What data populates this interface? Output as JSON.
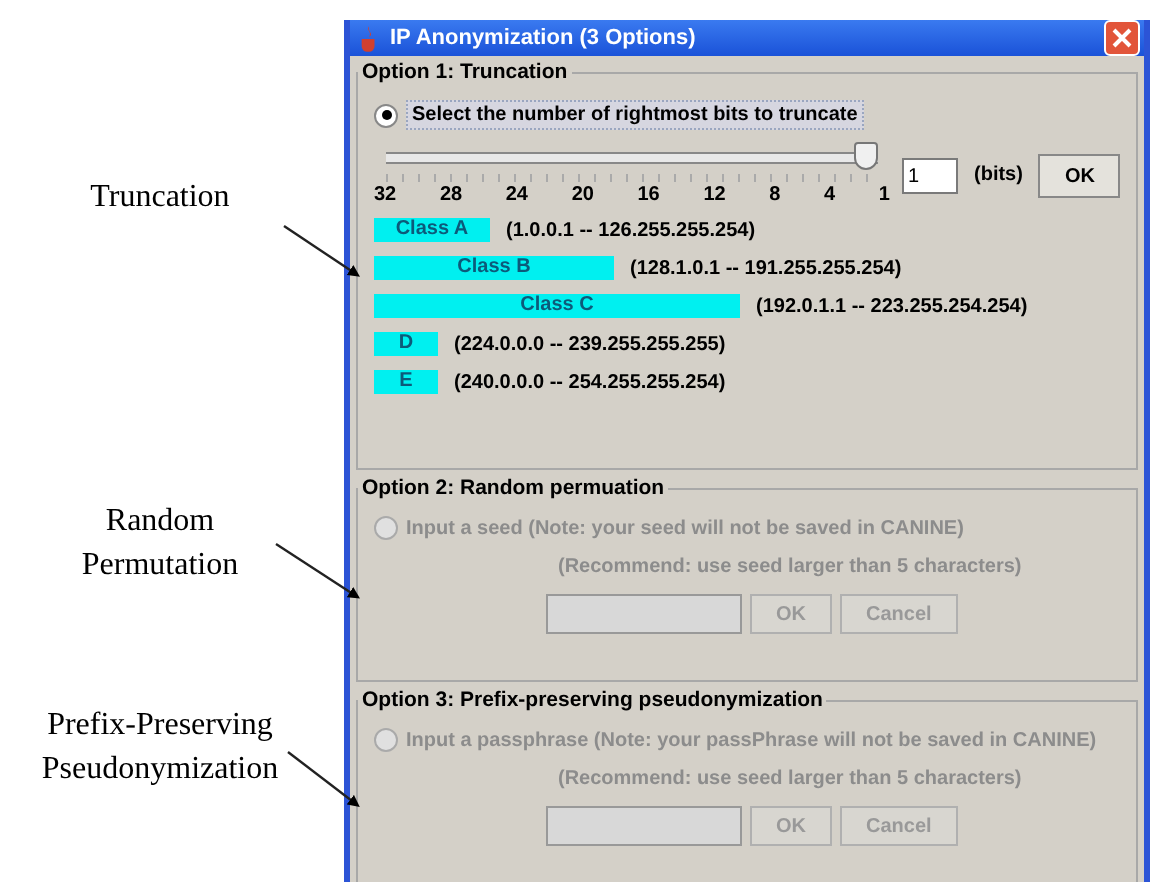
{
  "annotations": [
    {
      "text": "Truncation"
    },
    {
      "text": "Random Permutation"
    },
    {
      "text": "Prefix-Preserving Pseudonymization"
    }
  ],
  "window": {
    "title": "IP Anonymization (3 Options)"
  },
  "options": [
    {
      "kind": "truncation",
      "title": "Option 1: Truncation",
      "disabled": false,
      "radio": {
        "label": "Select the number of rightmost bits to truncate",
        "selected": true
      },
      "slider": {
        "level": 1,
        "ticks": [
          "32",
          "28",
          "24",
          "20",
          "16",
          "12",
          "8",
          "4",
          "1"
        ]
      },
      "bits_field": {
        "value": "1"
      },
      "unit": "(bits)",
      "button": "OK",
      "classes": [
        {
          "label": "Class A",
          "range": "(1.0.0.1 -- 126.255.255.254)"
        },
        {
          "label": "Class B",
          "range": "(128.1.0.1 -- 191.255.255.254)"
        },
        {
          "label": "Class C",
          "range": "(192.0.1.1 -- 223.255.254.254)"
        },
        {
          "label": "D",
          "range": "(224.0.0.0 -- 239.255.255.255)"
        },
        {
          "label": "E",
          "range": "(240.0.0.0 -- 254.255.255.254)"
        }
      ]
    },
    {
      "kind": "input",
      "title": "Option 2: Random permuation",
      "disabled": true,
      "radio": {
        "label": "Input a seed (Note: your seed will not be saved in CANINE)",
        "selected": false
      },
      "hint": "(Recommend: use seed larger than 5 characters)",
      "buttons": [
        "OK",
        "Cancel"
      ]
    },
    {
      "kind": "input",
      "title": "Option 3: Prefix-preserving pseudonymization",
      "disabled": true,
      "radio": {
        "label": "Input a passphrase (Note: your passPhrase will not be saved in CANINE)",
        "selected": false
      },
      "hint": "(Recommend: use seed larger than 5 characters)",
      "buttons": [
        "OK",
        "Cancel"
      ]
    }
  ]
}
